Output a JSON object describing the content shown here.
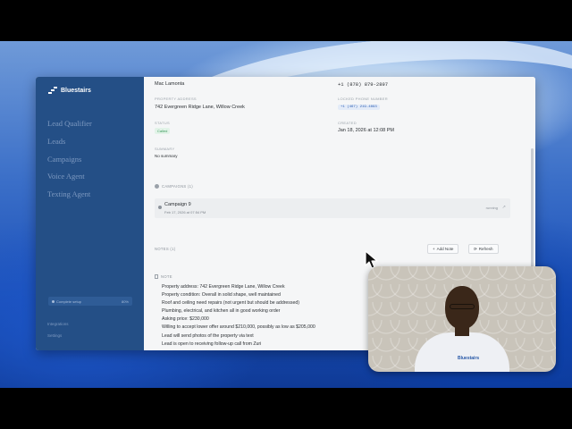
{
  "app": {
    "brand_name": "Bluestairs"
  },
  "sidebar": {
    "nav_items": [
      {
        "label": "Lead Qualifier"
      },
      {
        "label": "Leads"
      },
      {
        "label": "Campaigns"
      },
      {
        "label": "Voice Agent"
      },
      {
        "label": "Texting Agent"
      }
    ],
    "setup_label": "Complete setup",
    "setup_progress": "80%",
    "footer_links": [
      "Integrations",
      "Settings"
    ]
  },
  "lead": {
    "name_value": "Mac Lamonta",
    "phone_value": "+1 (878) 879-2897",
    "property_address_label": "PROPERTY ADDRESS",
    "property_address_value": "742 Evergreen Ridge Lane, Willow Creek",
    "locked_phone_label": "LOCKED PHONE NUMBER",
    "locked_phone_value": "+1 (467) 219-4893",
    "status_label": "STATUS",
    "status_value": "Called",
    "created_label": "CREATED",
    "created_value": "Jan 18, 2026 at 12:08 PM",
    "summary_label": "SUMMARY",
    "summary_value": "No summary"
  },
  "campaigns": {
    "header": "CAMPAIGNS (1)",
    "items": [
      {
        "name": "Campaign 9",
        "date": "Feb 17, 2026 at 07:54 PM",
        "status": "running"
      }
    ]
  },
  "notes": {
    "header": "NOTES (1)",
    "add_button": "Add Note",
    "refresh_button": "Refresh",
    "note_label": "NOTE",
    "note_lines": [
      "Property address: 742 Evergreen Ridge Lane, Willow Creek",
      "Property condition: Overall in solid shape, well maintained",
      "Roof and ceiling need repairs (not urgent but should be addressed)",
      "Plumbing, electrical, and kitchen all in good working order",
      "Asking price: $230,000",
      "Willing to accept lower offer around $210,000, possibly as low as $205,000",
      "Lead will send photos of the property via text",
      "Lead is open to receiving follow-up call from Zuri"
    ]
  },
  "webcam": {
    "shirt_text": "Bluestairs"
  },
  "colors": {
    "sidebar_bg": "#244f86",
    "status_green": "#3b9a5c",
    "accent_blue": "#2c5fb3"
  }
}
